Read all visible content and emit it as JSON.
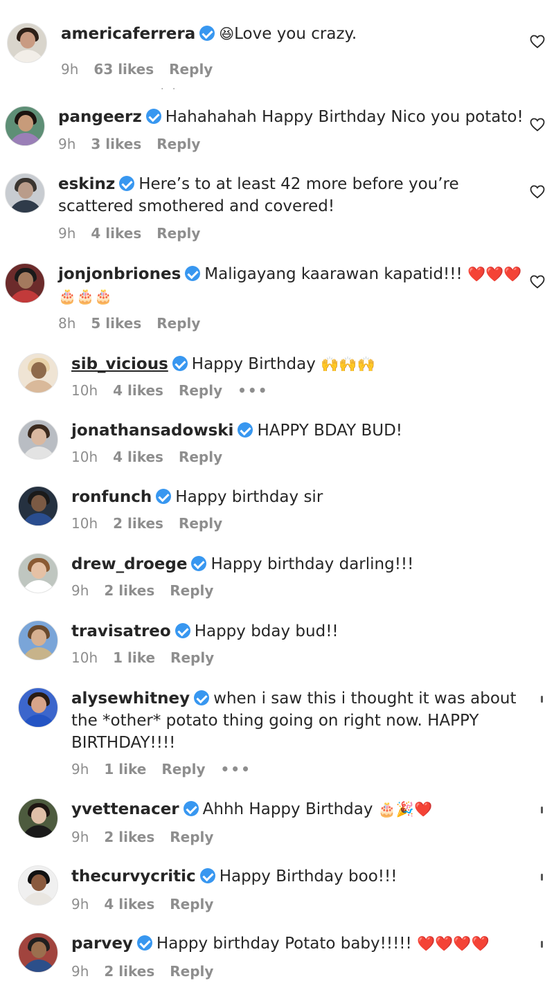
{
  "colors": {
    "verified": "#3897f0",
    "meta": "#8e8e8e",
    "heart_red": "#e0262b"
  },
  "faint_marker": ". .",
  "comments": [
    {
      "user": "americaferrera",
      "text": "Love you crazy.",
      "emoji_before": "😆",
      "emoji_after": "",
      "time": "9h",
      "likes": "63 likes",
      "reply": "Reply",
      "more": ""
    },
    {
      "user": "pangeerz",
      "text": "Hahahahah Happy Birthday Nico you potato!",
      "emoji_before": "",
      "emoji_after": "",
      "time": "9h",
      "likes": "3 likes",
      "reply": "Reply",
      "more": ""
    },
    {
      "user": "eskinz",
      "text": "Here’s to at least 42 more before you’re scattered smothered and covered!",
      "emoji_before": "",
      "emoji_after": "",
      "time": "9h",
      "likes": "4 likes",
      "reply": "Reply",
      "more": ""
    },
    {
      "user": "jonjonbriones",
      "text": "Maligayang kaarawan kapatid!!!",
      "emoji_before": "",
      "emoji_after": "❤️❤️❤️🎂🎂🎂",
      "time": "8h",
      "likes": "5 likes",
      "reply": "Reply",
      "more": ""
    },
    {
      "user": "sib_vicious",
      "text": "Happy Birthday",
      "emoji_before": "",
      "emoji_after": "🙌🙌🙌",
      "time": "10h",
      "likes": "4 likes",
      "reply": "Reply",
      "more": "•••"
    },
    {
      "user": "jonathansadowski",
      "text": "HAPPY BDAY BUD!",
      "emoji_before": "",
      "emoji_after": "",
      "time": "10h",
      "likes": "4 likes",
      "reply": "Reply",
      "more": ""
    },
    {
      "user": "ronfunch",
      "text": "Happy birthday sir",
      "emoji_before": "",
      "emoji_after": "",
      "time": "10h",
      "likes": "2 likes",
      "reply": "Reply",
      "more": ""
    },
    {
      "user": "drew_droege",
      "text": "Happy birthday darling!!!",
      "emoji_before": "",
      "emoji_after": "",
      "time": "9h",
      "likes": "2 likes",
      "reply": "Reply",
      "more": ""
    },
    {
      "user": "travisatreo",
      "text": "Happy bday bud!!",
      "emoji_before": "",
      "emoji_after": "",
      "time": "10h",
      "likes": "1 like",
      "reply": "Reply",
      "more": ""
    },
    {
      "user": "alysewhitney",
      "text": "when i saw this i thought it was about the *other* potato thing going on right now. HAPPY BIRTHDAY!!!!",
      "emoji_before": "",
      "emoji_after": "",
      "time": "9h",
      "likes": "1 like",
      "reply": "Reply",
      "more": "•••"
    },
    {
      "user": "yvettenacer",
      "text": "Ahhh Happy Birthday",
      "emoji_before": "",
      "emoji_after": "🎂🎉❤️",
      "time": "9h",
      "likes": "2 likes",
      "reply": "Reply",
      "more": ""
    },
    {
      "user": "thecurvycritic",
      "text": "Happy Birthday boo!!!",
      "emoji_before": "",
      "emoji_after": "",
      "time": "9h",
      "likes": "4 likes",
      "reply": "Reply",
      "more": ""
    },
    {
      "user": "parvey",
      "text": "Happy birthday Potato baby!!!!!",
      "emoji_before": "",
      "emoji_after": "❤️❤️❤️❤️",
      "time": "9h",
      "likes": "2 likes",
      "reply": "Reply",
      "more": ""
    }
  ]
}
